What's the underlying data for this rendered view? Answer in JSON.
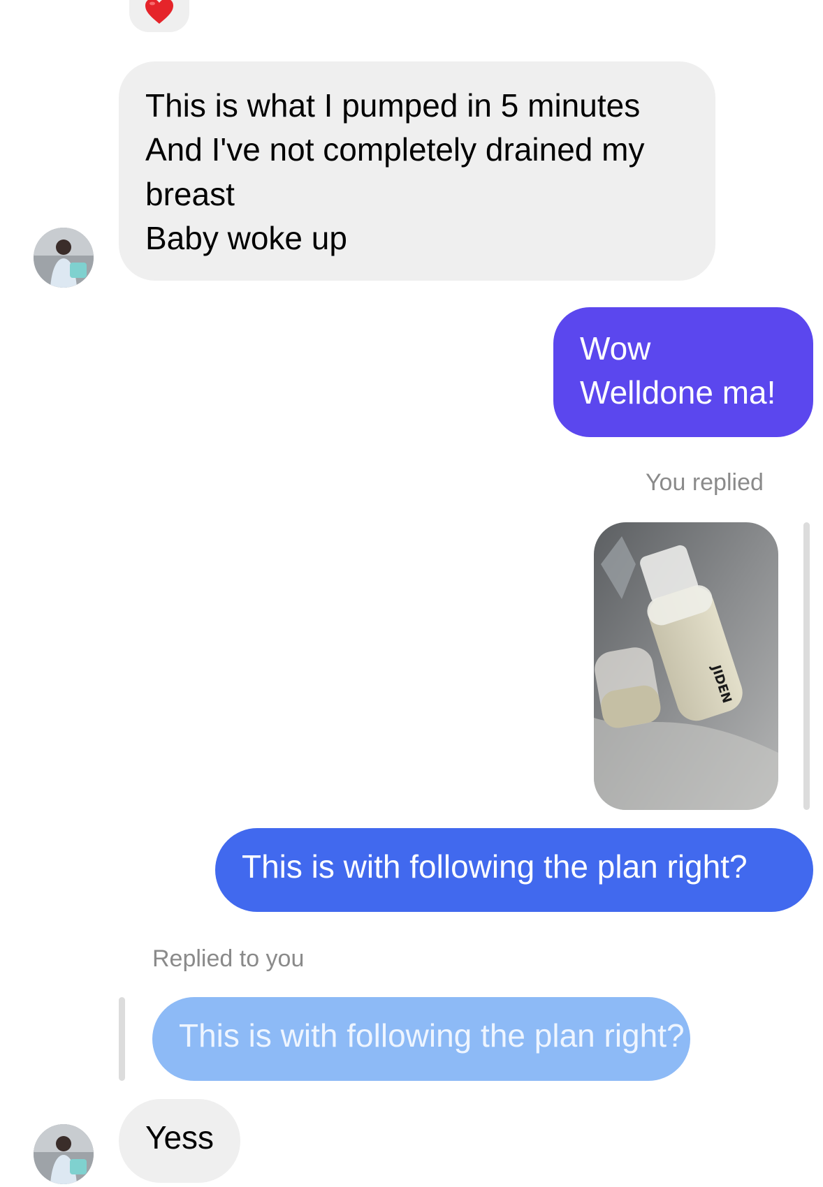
{
  "reaction": {
    "icon": "red-heart-icon"
  },
  "avatar": {
    "icon": "user-avatar-photo"
  },
  "messages": [
    {
      "sender": "other",
      "lines": [
        "This is what I pumped in 5 minutes",
        "And I've not completely drained my",
        "breast",
        "Baby woke up"
      ]
    },
    {
      "sender": "me",
      "lines": [
        "Wow",
        "Welldone ma!"
      ]
    },
    {
      "sender": "me",
      "reply_label": "You replied",
      "photo": {
        "icon": "milk-bottles-photo",
        "brand_text": "JIDEN"
      }
    },
    {
      "sender": "me",
      "text": "This is with following the plan right?"
    },
    {
      "sender": "other",
      "reply_label": "Replied to you",
      "quoted_text": "This is with following the plan right?",
      "text": "Yess"
    }
  ],
  "colors": {
    "incoming_bubble": "#efefef",
    "outgoing_purple": "#5b47ee",
    "outgoing_blue": "#4169ee",
    "quoted_bubble": "#8dbaf6",
    "meta_text": "#8a8a8a"
  }
}
